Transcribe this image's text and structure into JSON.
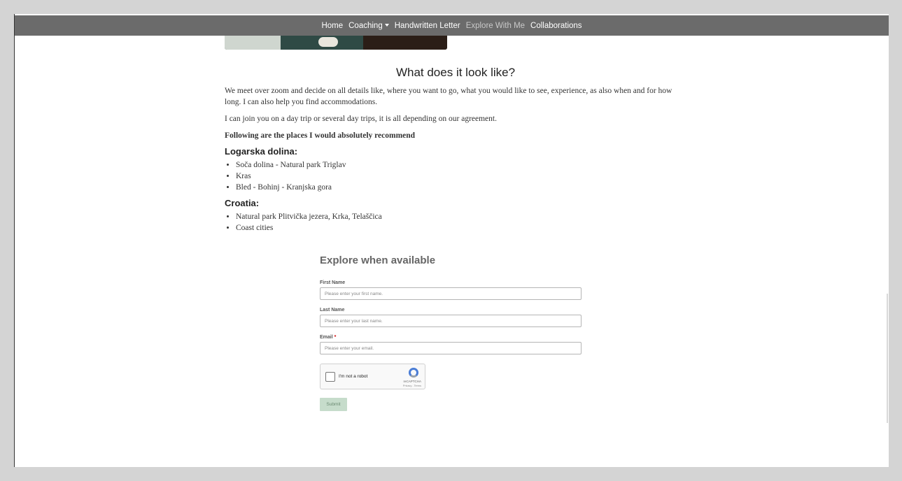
{
  "nav": {
    "items": [
      {
        "label": "Home"
      },
      {
        "label": "Coaching"
      },
      {
        "label": "Handwritten Letter"
      },
      {
        "label": "Explore With Me"
      },
      {
        "label": "Collaborations"
      }
    ]
  },
  "main": {
    "heading": "What does it look like?",
    "paragraph1": "We meet over zoom and decide on all details like, where you want to go, what you would like to see, experience, as also when and for how long. I can also help you find accommodations.",
    "paragraph2": "I can join you on a day trip or several day trips, it is all depending on our agreement.",
    "recommend_note": "Following are the places I would absolutely recommend",
    "sections": [
      {
        "title": "Logarska dolina:",
        "items": [
          "Soča dolina - Natural park Triglav",
          "Kras",
          "Bled - Bohinj - Kranjska gora"
        ]
      },
      {
        "title": "Croatia:",
        "items": [
          "Natural park Plitvička jezera, Krka, Telaščica",
          "Coast cities"
        ]
      }
    ]
  },
  "form": {
    "title": "Explore when available",
    "first_name_label": "First Name",
    "first_name_placeholder": "Please enter your first name.",
    "last_name_label": "Last Name",
    "last_name_placeholder": "Please enter your last name.",
    "email_label": "Email",
    "email_required_mark": "*",
    "email_placeholder": "Please enter your email.",
    "captcha_text": "I'm not a robot",
    "captcha_brand": "reCAPTCHA",
    "captcha_terms": "Privacy - Terms",
    "submit_label": "Submit"
  }
}
